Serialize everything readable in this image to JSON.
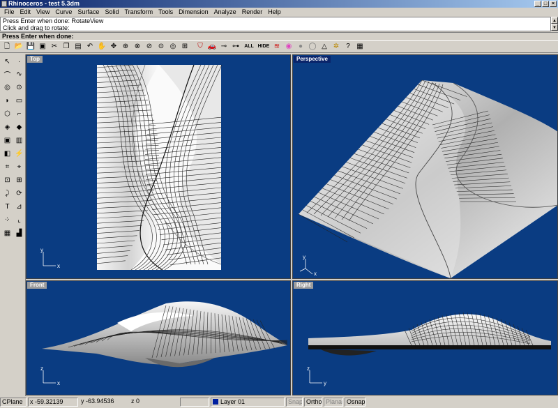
{
  "window": {
    "title": "Rhinoceros - test 5.3dm"
  },
  "menu": [
    "File",
    "Edit",
    "View",
    "Curve",
    "Surface",
    "Solid",
    "Transform",
    "Tools",
    "Dimension",
    "Analyze",
    "Render",
    "Help"
  ],
  "command": {
    "history": [
      "Press Enter when done: RotateView",
      "Click and drag to rotate:"
    ],
    "prompt": "Press Enter when done:"
  },
  "toolbar": {
    "icons": [
      "new-icon",
      "open-icon",
      "save-icon",
      "print-icon",
      "cut-icon",
      "copy-icon",
      "paste-icon",
      "undo-icon",
      "pan-icon",
      "rotate-view-icon",
      "zoom-icon",
      "zoom-window-icon",
      "zoom-extents-icon",
      "zoom-selected-icon",
      "zoom-target-icon",
      "viewport-layout-icon",
      "sep",
      "select-filter-icon",
      "car-icon",
      "point-icon",
      "cplane-icon",
      "all-icon",
      "hide-icon",
      "layer-icon",
      "color-wheel-icon",
      "sphere-icon",
      "light-icon",
      "properties-icon",
      "help-icon",
      "notes-icon"
    ],
    "all_label": "ALL",
    "hide_label": "HIDE"
  },
  "viewports": {
    "top": {
      "title": "Top",
      "axis_x": "x",
      "axis_y": "y"
    },
    "perspective": {
      "title": "Perspective",
      "axis_x": "x",
      "axis_y": "y"
    },
    "front": {
      "title": "Front",
      "axis_x": "x",
      "axis_y": "z"
    },
    "right": {
      "title": "Right",
      "axis_x": "y",
      "axis_y": "z"
    }
  },
  "status": {
    "cplane": "CPlane",
    "x": "x -59.32139",
    "y": "y -63.94536",
    "z": "z 0",
    "layer": "Layer 01",
    "snap": "Snap",
    "ortho": "Ortho",
    "planar": "Planar",
    "osnap": "Osnap"
  },
  "colors": {
    "viewport_bg": "#0a3c82",
    "title_active": "#0a246a",
    "layer_color": "#0020a0"
  }
}
